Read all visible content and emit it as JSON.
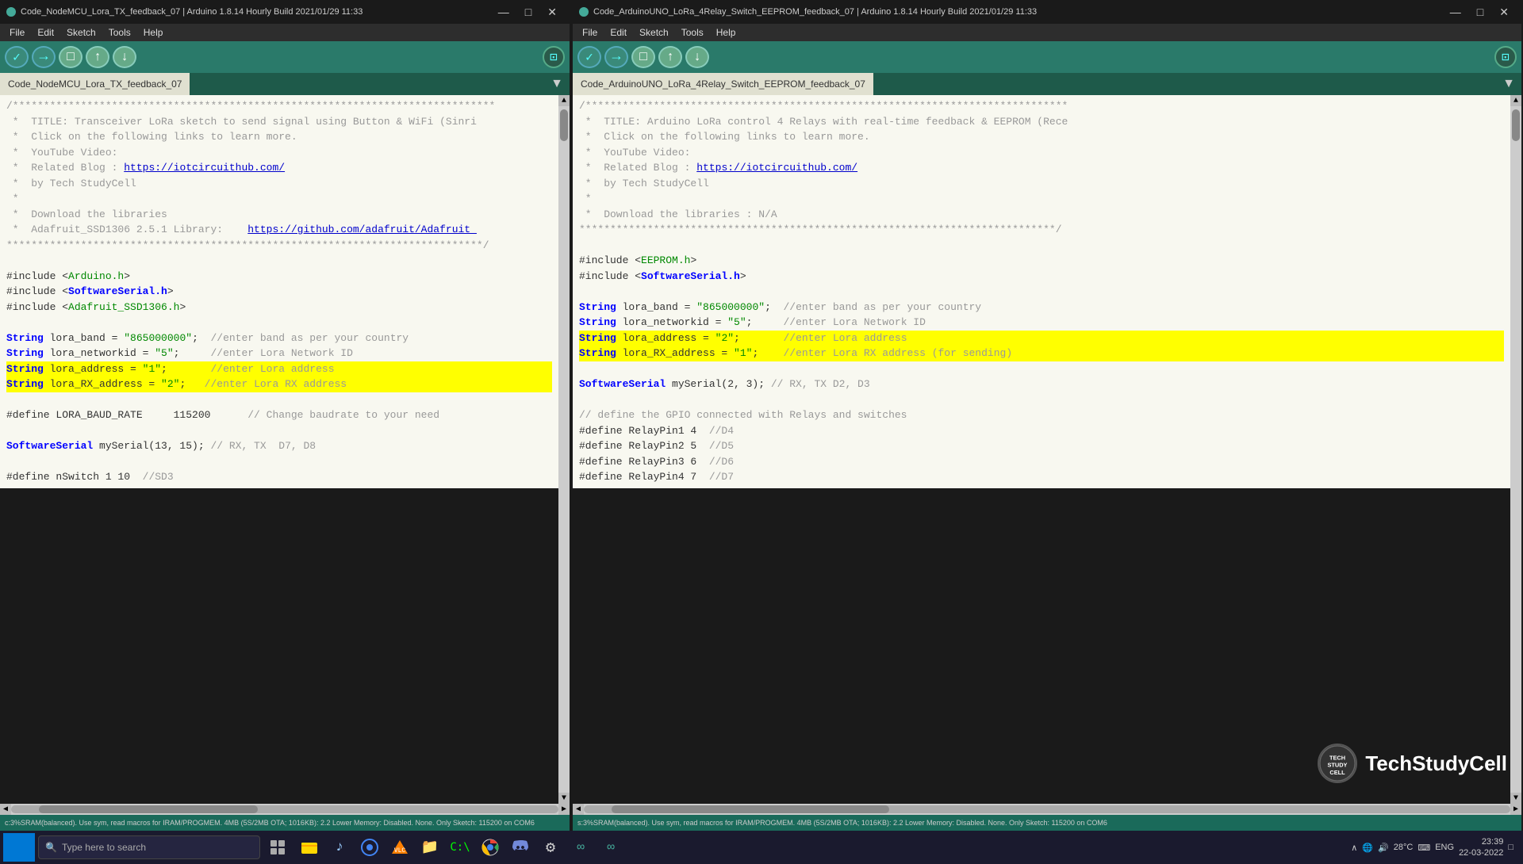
{
  "window_left": {
    "title": "Code_NodeMCU_Lora_TX_feedback_07 | Arduino 1.8.14 Hourly Build 2021/01/29 11:33",
    "tab_name": "Code_NodeMCU_Lora_TX_feedback_07",
    "menu": [
      "File",
      "Edit",
      "Sketch",
      "Tools",
      "Help"
    ],
    "toolbar_buttons": {
      "verify_label": "✓",
      "upload_label": "→",
      "new_label": "□",
      "open_label": "↑",
      "save_label": "↓"
    },
    "code_lines": [
      "/*****************************************************************************",
      " *  TITLE: Transceiver LoRa sketch to send signal using Button & WiFi (Sinri",
      " *  Click on the following links to learn more.",
      " *  YouTube Video:",
      " *  Related Blog : https://iotcircuithub.com/",
      " *  by Tech StudyCell",
      " *",
      " *  Download the libraries",
      " *  Adafruit_SSD1306 2.5.1 Library:    https://github.com/adafruit/Adafruit_",
      "*****************************************************************************/",
      "",
      "#include <Arduino.h>",
      "#include <SoftwareSerial.h>",
      "#include <Adafruit_SSD1306.h>",
      "",
      "String lora_band = \"865000000\";  //enter band as per your country",
      "String lora_networkid = \"5\";     //enter Lora Network ID",
      "String lora_address = \"1\";       //enter Lora address",
      "String lora_RX_address = \"2\";   //enter Lora RX address",
      "",
      "#define LORA_BAUD_RATE     115200      // Change baudrate to your need",
      "",
      "SoftwareSerial mySerial(13, 15); // RX, TX  D7, D8",
      "",
      "#define nSwitch 1 10  //SD3"
    ],
    "status": "c:3%SRAM(balanced). Use sym, read macros for IRAM/PROGMEM. 4MB (5S/2MB OTA; 1016KB): 2.2 Lower Memory: Disabled. None. Only Sketch: 115200 on COM6"
  },
  "window_right": {
    "title": "Code_ArduinoUNO_LoRa_4Relay_Switch_EEPROM_feedback_07 | Arduino 1.8.14 Hourly Build 2021/01/29 11:33",
    "tab_name": "Code_ArduinoUNO_LoRa_4Relay_Switch_EEPROM_feedback_07",
    "menu": [
      "File",
      "Edit",
      "Sketch",
      "Tools",
      "Help"
    ],
    "code_lines": [
      "/*****************************************************************************",
      " *  TITLE: Arduino LoRa control 4 Relays with real-time feedback & EEPROM (Rece",
      " *  Click on the following links to learn more.",
      " *  YouTube Video:",
      " *  Related Blog : https://iotcircuithub.com/",
      " *  by Tech StudyCell",
      " *",
      " *  Download the libraries : N/A",
      "*****************************************************************************/",
      "",
      "#include <EEPROM.h>",
      "#include <SoftwareSerial.h>",
      "",
      "String lora_band = \"865000000\";  //enter band as per your country",
      "String lora_networkid = \"5\";     //enter Lora Network ID",
      "String lora_address = \"2\";       //enter Lora address",
      "String lora_RX_address = \"1\";    //enter Lora RX address (for sending)",
      "",
      "SoftwareSerial mySerial(2, 3); // RX, TX D2, D3",
      "",
      "// define the GPIO connected with Relays and switches",
      "#define RelayPin1 4  //D4",
      "#define RelayPin2 5  //D5",
      "#define RelayPin3 6  //D6",
      "#define RelayPin4 7  //D7"
    ],
    "status": "s:3%SRAM(balanced). Use sym, read macros for IRAM/PROGMEM. 4MB (5S/2MB OTA; 1016KB): 2.2 Lower Memory: Disabled. None. Only Sketch: 115200 on COM6"
  },
  "watermark": {
    "channel": "TechStudyCell",
    "logo_text": "TECH\nSTUDY\nCELL"
  },
  "taskbar": {
    "search_placeholder": "Type here to search",
    "time": "23:39",
    "date": "22-03-2022",
    "temperature": "28°C",
    "language": "ENG"
  }
}
